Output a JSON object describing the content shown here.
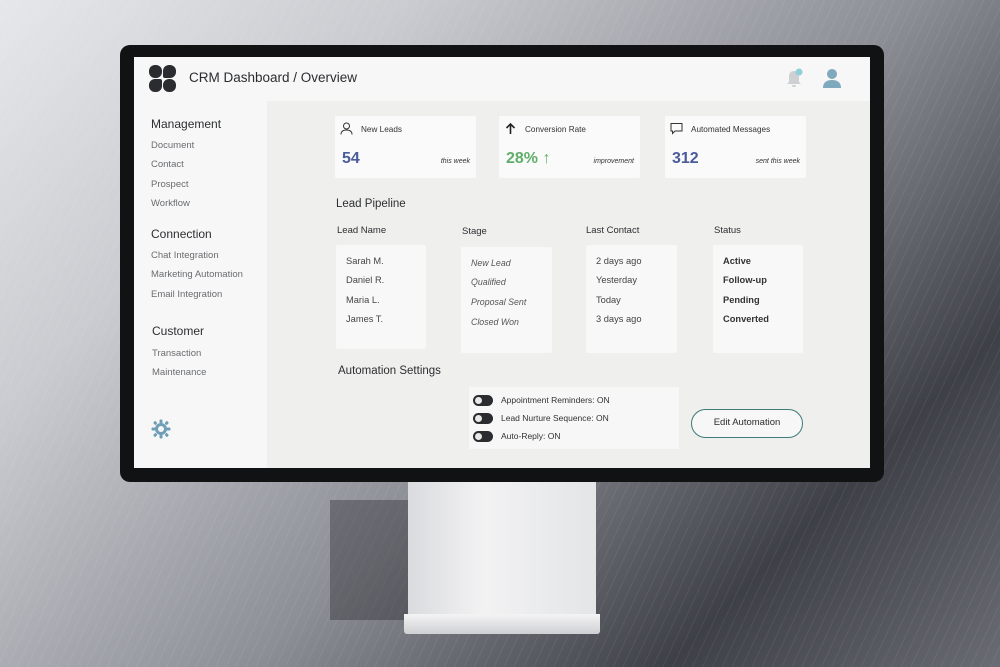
{
  "header": {
    "title": "CRM Dashboard / Overview",
    "notification_count": ""
  },
  "sidebar": {
    "groups": [
      {
        "label": "Management",
        "items": [
          "Document",
          "Contact",
          "Prospect",
          "Workflow"
        ]
      },
      {
        "label": "Connection",
        "items": [
          "Chat Integration",
          "Marketing Automation",
          "Email Integration"
        ]
      },
      {
        "label": "Customer",
        "items": [
          "Transaction",
          "Maintenance"
        ]
      }
    ]
  },
  "cards": [
    {
      "title": "New Leads",
      "value": "54",
      "sub": "this week",
      "icon": "user-icon",
      "value_color": "#4a5b9a"
    },
    {
      "title": "Conversion Rate",
      "value": "28% ↑",
      "sub": "improvement",
      "icon": "arrow-up-icon",
      "value_color": "#5fae6a"
    },
    {
      "title": "Automated Messages",
      "value": "312",
      "sub": "sent this week",
      "icon": "message-icon",
      "value_color": "#4a5b9a"
    }
  ],
  "pipeline": {
    "title": "Lead Pipeline",
    "headers": [
      "Lead Name",
      "Stage",
      "Last Contact",
      "Status"
    ],
    "names": [
      "Sarah M.",
      "Daniel R.",
      "Maria L.",
      "James T."
    ],
    "stages": [
      "New Lead",
      "Qualified",
      "Proposal Sent",
      "Closed Won"
    ],
    "contacts": [
      "2 days ago",
      "Yesterday",
      "Today",
      "3 days ago"
    ],
    "statuses": [
      "Active",
      "Follow-up",
      "Pending",
      "Converted"
    ]
  },
  "automation": {
    "title": "Automation Settings",
    "toggles": [
      "Appointment Reminders: ON",
      "Lead Nurture Sequence: ON",
      "Auto-Reply: ON"
    ],
    "edit_label": "Edit Automation"
  },
  "colors": {
    "accent_teal": "#3d7d77",
    "dark": "#2b2c2f",
    "positive": "#5fae6a",
    "value_blue": "#4a5b9a"
  }
}
